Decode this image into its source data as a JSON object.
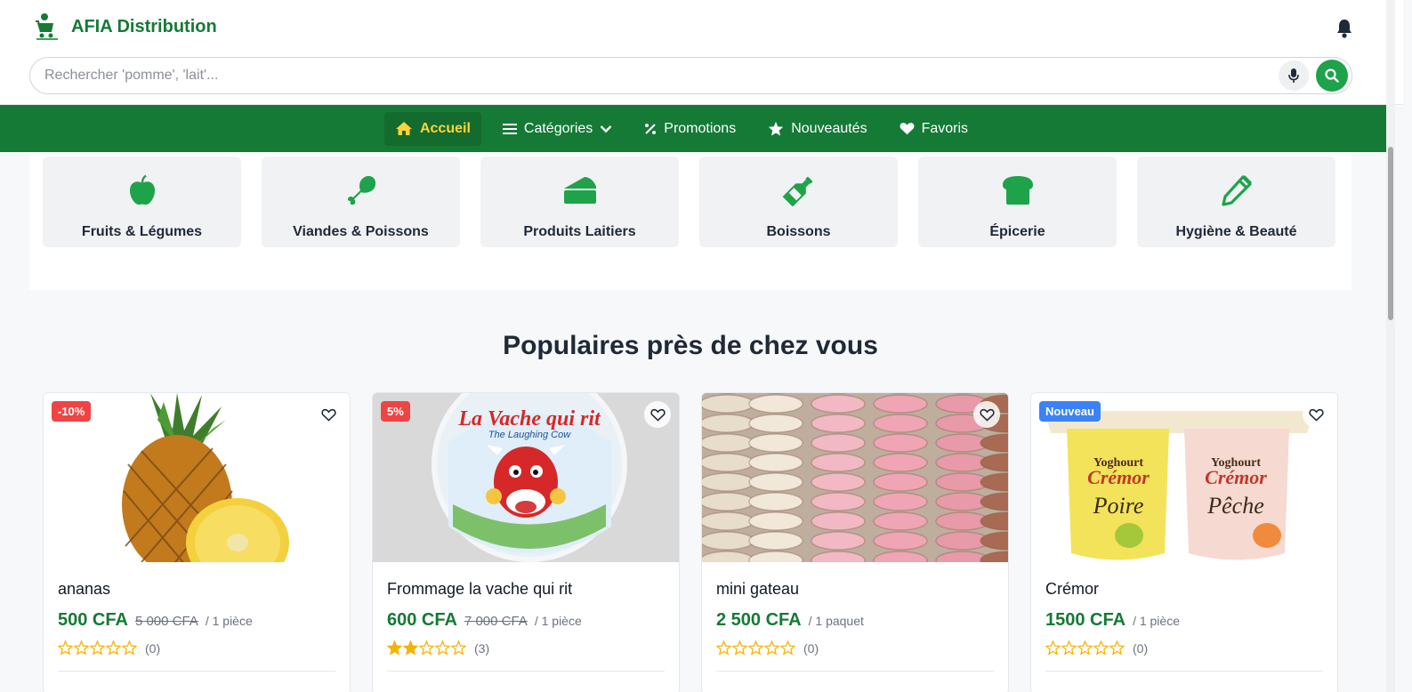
{
  "brand": {
    "name": "AFIA Distribution",
    "logo_icon": "grocery-cart-logo",
    "accent": "#157a35"
  },
  "search": {
    "placeholder": "Rechercher 'pomme', 'lait'..."
  },
  "nav": {
    "items": [
      {
        "label": "Accueil",
        "icon": "home-icon",
        "active": true
      },
      {
        "label": "Catégories",
        "icon": "bars-icon",
        "dropdown": true
      },
      {
        "label": "Promotions",
        "icon": "percent-icon"
      },
      {
        "label": "Nouveautés",
        "icon": "star-icon"
      },
      {
        "label": "Favoris",
        "icon": "heart-icon"
      }
    ]
  },
  "categories": [
    {
      "label": "Fruits & Légumes",
      "icon": "apple-icon"
    },
    {
      "label": "Viandes & Poissons",
      "icon": "drumstick-icon"
    },
    {
      "label": "Produits Laitiers",
      "icon": "cheese-icon"
    },
    {
      "label": "Boissons",
      "icon": "bottle-icon"
    },
    {
      "label": "Épicerie",
      "icon": "bread-icon"
    },
    {
      "label": "Hygiène & Beauté",
      "icon": "pencil-icon"
    }
  ],
  "section": {
    "title": "Populaires près de chez vous"
  },
  "products": [
    {
      "name": "ananas",
      "price": "500 CFA",
      "old_price": "5 000 CFA",
      "unit": "/ 1 pièce",
      "rating": 0,
      "reviews": "(0)",
      "badge": "-10%",
      "badge_color": "#ef4444",
      "image": "pineapple"
    },
    {
      "name": "Frommage la vache qui rit",
      "price": "600 CFA",
      "old_price": "7 000 CFA",
      "unit": "/ 1 pièce",
      "rating": 2,
      "reviews": "(3)",
      "badge": "5%",
      "badge_color": "#ef4444",
      "image": "cheese-box",
      "image_text": "La Vache qui rit",
      "image_subtext": "The Laughing Cow"
    },
    {
      "name": "mini gateau",
      "price": "2 500 CFA",
      "old_price": "",
      "unit": "/ 1 paquet",
      "rating": 0,
      "reviews": "(0)",
      "badge": "",
      "image": "macarons"
    },
    {
      "name": "Crémor",
      "price": "1500 CFA",
      "old_price": "",
      "unit": "/ 1 pièce",
      "rating": 0,
      "reviews": "(0)",
      "badge": "Nouveau",
      "badge_color": "#3b82f6",
      "image": "yoghurt",
      "image_text": "Crémor",
      "image_subtext": "Yoghourt",
      "flavor1": "Poire",
      "flavor2": "Pêche"
    }
  ]
}
